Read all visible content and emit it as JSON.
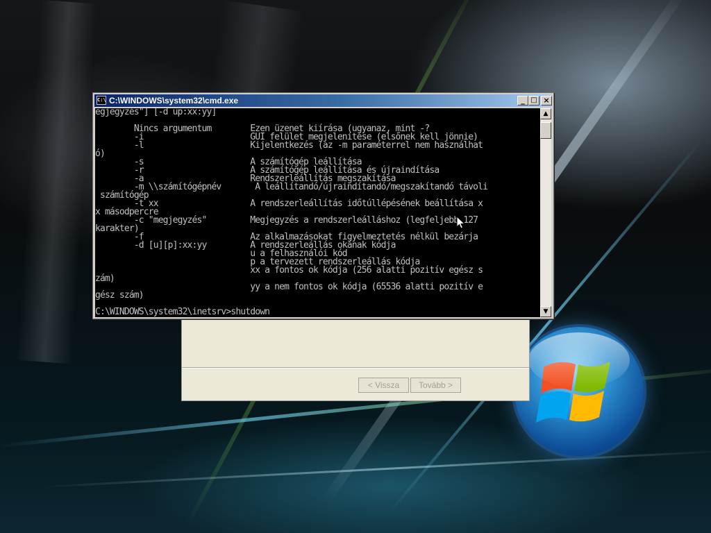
{
  "window": {
    "title": "C:\\WINDOWS\\system32\\cmd.exe",
    "icon_label": "C:\\",
    "minimize_glyph": "_",
    "maximize_glyph": "□",
    "close_glyph": "×"
  },
  "console": {
    "lines": [
      "egjegyzés\"] [-d up:xx:yy]",
      "",
      "        Nincs argumentum        Ezen üzenet kiírása (ugyanaz, mint -?",
      "        -i                      GUI felület megjelenítése (elsőnek kell jönnie)",
      "        -l                      Kijelentkezés (az -m paraméterrel nem használhat",
      "ó)",
      "        -s                      A számítógép leállítása",
      "        -r                      A számítógép leállítása és újraindítása",
      "        -a                      Rendszerleállítás megszakítása",
      "        -m \\\\számítógépnév       A leállítandó/újraindítandó/megszakítandó távoli",
      " számítógép",
      "        -t xx                   A rendszerleállítás időtúllépésének beállítása x",
      "x másodpercre",
      "        -c \"megjegyzés\"         Megjegyzés a rendszerleálláshoz (legfeljebb 127",
      "karakter)",
      "        -f                      Az alkalmazásokat figyelmeztetés nélkül bezárja",
      "        -d [u][p]:xx:yy         A rendszerleállás okának kódja",
      "                                u a felhasználói kód",
      "                                p a tervezett rendszerleállás kódja",
      "                                xx a fontos ok kódja (256 alatti pozitív egész s",
      "zám)",
      "                                yy a nem fontos ok kódja (65536 alatti pozitív e",
      "gész szám)",
      "",
      "C:\\WINDOWS\\system32\\inetsrv>shutdown"
    ]
  },
  "scrollbar": {
    "up_glyph": "▲",
    "down_glyph": "▼"
  },
  "wizard": {
    "back_label": "< Vissza",
    "next_label": "Tovább >"
  },
  "colors": {
    "console_bg": "#000000",
    "console_text": "#c0c0c0",
    "titlebar_start": "#0a246a",
    "titlebar_end": "#a6caf0"
  },
  "icons": {
    "logo": "windows-flag-logo",
    "cursor": "mouse-pointer-icon",
    "app": "cmd-icon"
  }
}
